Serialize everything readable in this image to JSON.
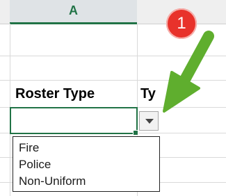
{
  "spreadsheet": {
    "column_header": "A",
    "cells": {
      "roster_type_label": "Roster Type",
      "next_header_partial": "Ty"
    }
  },
  "dropdown": {
    "options": [
      "Fire",
      "Police",
      "Non-Uniform"
    ]
  },
  "annotation": {
    "badge_number": "1",
    "badge_color": "#e8322b",
    "arrow_color": "#5fae2e"
  },
  "colors": {
    "accent": "#217346"
  }
}
